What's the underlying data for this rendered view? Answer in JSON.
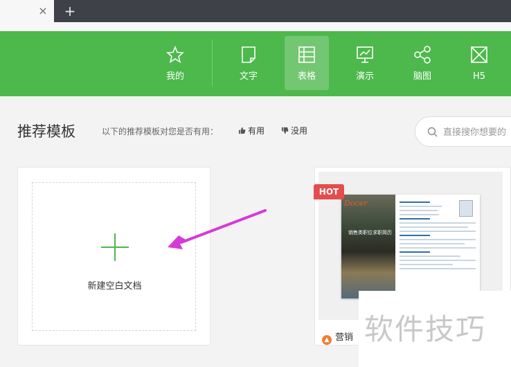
{
  "browser": {
    "close_symbol": "×",
    "new_tab_symbol": "+"
  },
  "toolbar": {
    "items": [
      {
        "label": "我的",
        "icon": "star-icon"
      },
      {
        "label": "文字",
        "icon": "document-icon"
      },
      {
        "label": "表格",
        "icon": "table-icon",
        "active": true
      },
      {
        "label": "演示",
        "icon": "presentation-icon"
      },
      {
        "label": "脑图",
        "icon": "mindmap-icon"
      },
      {
        "label": "H5",
        "icon": "h5-icon"
      }
    ]
  },
  "header": {
    "title": "推荐模板",
    "hint": "以下的推荐模板对您是否有用：",
    "useful_label": "有用",
    "useless_label": "没用"
  },
  "search": {
    "placeholder": "直接搜你想要的"
  },
  "cards": {
    "new_doc_label": "新建空白文档",
    "template": {
      "badge": "HOT",
      "logo_text": "Docer",
      "preview_title": "销售类职位求职简历",
      "name": "营销"
    }
  },
  "watermark": {
    "text": "软件技巧"
  },
  "colors": {
    "brand_green": "#4db84b",
    "hot_red": "#e44d4d",
    "arrow_magenta": "#d63ad6"
  }
}
